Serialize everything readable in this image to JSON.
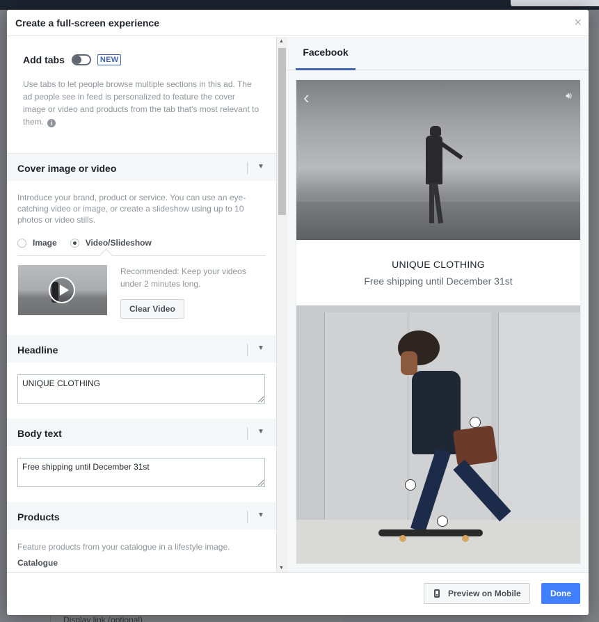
{
  "modal": {
    "title": "Create a full-screen experience",
    "close_glyph": "×"
  },
  "background": {
    "display_link_label": "Display link (optional)"
  },
  "tabs_section": {
    "label": "Add tabs",
    "toggle_on": false,
    "badge": "NEW",
    "description": "Use tabs to let people browse multiple sections in this ad. The ad people see in feed is personalized to feature the cover image or video and products from the tab that's most relevant to them."
  },
  "cover_section": {
    "title": "Cover image or video",
    "description": "Introduce your brand, product or service. You can use an eye-catching video or image, or create a slideshow using up to 10 photos or video stills.",
    "options": [
      {
        "label": "Image",
        "selected": false
      },
      {
        "label": "Video/Slideshow",
        "selected": true
      }
    ],
    "recommendation": "Recommended: Keep your videos under 2 minutes long.",
    "clear_label": "Clear Video"
  },
  "headline_section": {
    "title": "Headline",
    "value": "UNIQUE CLOTHING"
  },
  "body_section": {
    "title": "Body text",
    "value": "Free shipping until December 31st"
  },
  "products_section": {
    "title": "Products",
    "description": "Feature products from your catalogue in a lifestyle image.",
    "catalogue_label": "Catalogue"
  },
  "preview": {
    "tab_label": "Facebook",
    "headline": "UNIQUE CLOTHING",
    "body": "Free shipping until December 31st"
  },
  "footer": {
    "preview_label": "Preview on Mobile",
    "done_label": "Done"
  },
  "colors": {
    "accent": "#4267b2",
    "primary_button": "#4080ff"
  },
  "icons": [
    "close-icon",
    "info-icon",
    "chevron-down-icon",
    "play-icon",
    "back-arrow-icon",
    "sound-icon",
    "mobile-phone-icon"
  ]
}
